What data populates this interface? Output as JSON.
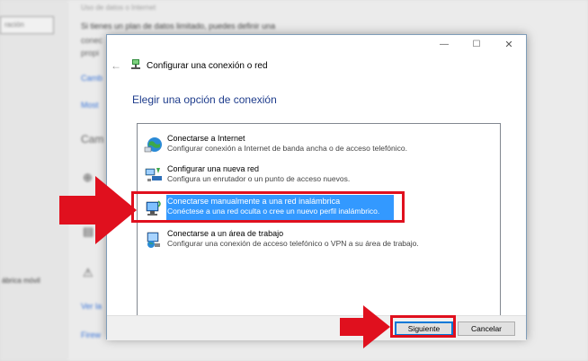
{
  "background": {
    "search_placeholder": "ración",
    "title_fragment": "Uso de datos o Internet",
    "line1": "Si tienes un plan de datos limitado, puedes definir una",
    "frag_conec": "conec",
    "frag_prop": "propi",
    "link_camb": "Camb",
    "link_most": "Most",
    "section_cam": "Cam",
    "link_ver": "Ver la",
    "link_firew": "Firew",
    "left_text": "ábrica móvil"
  },
  "dialog": {
    "title": "Configurar una conexión o red",
    "heading": "Elegir una opción de conexión",
    "options": [
      {
        "title": "Conectarse a Internet",
        "desc": "Configurar conexión a Internet de banda ancha o de acceso telefónico.",
        "icon": "globe-network-icon"
      },
      {
        "title": "Configurar una nueva red",
        "desc": "Configura un enrutador o un punto de acceso nuevos.",
        "icon": "router-icon"
      },
      {
        "title": "Conectarse manualmente a una red inalámbrica",
        "desc": "Conéctese a una red oculta o cree un nuevo perfil inalámbrico.",
        "icon": "wireless-computer-icon"
      },
      {
        "title": "Conectarse a un área de trabajo",
        "desc": "Configurar una conexión de acceso telefónico o VPN a su área de trabajo.",
        "icon": "workplace-network-icon"
      }
    ],
    "selected_index": 2,
    "next_label": "Siguiente",
    "cancel_label": "Cancelar",
    "minimize_symbol": "—",
    "maximize_symbol": "☐",
    "close_symbol": "✕",
    "back_symbol": "←"
  },
  "colors": {
    "selection": "#3399ff",
    "annotation_red": "#e0101e",
    "heading_blue": "#1e3c8c"
  }
}
